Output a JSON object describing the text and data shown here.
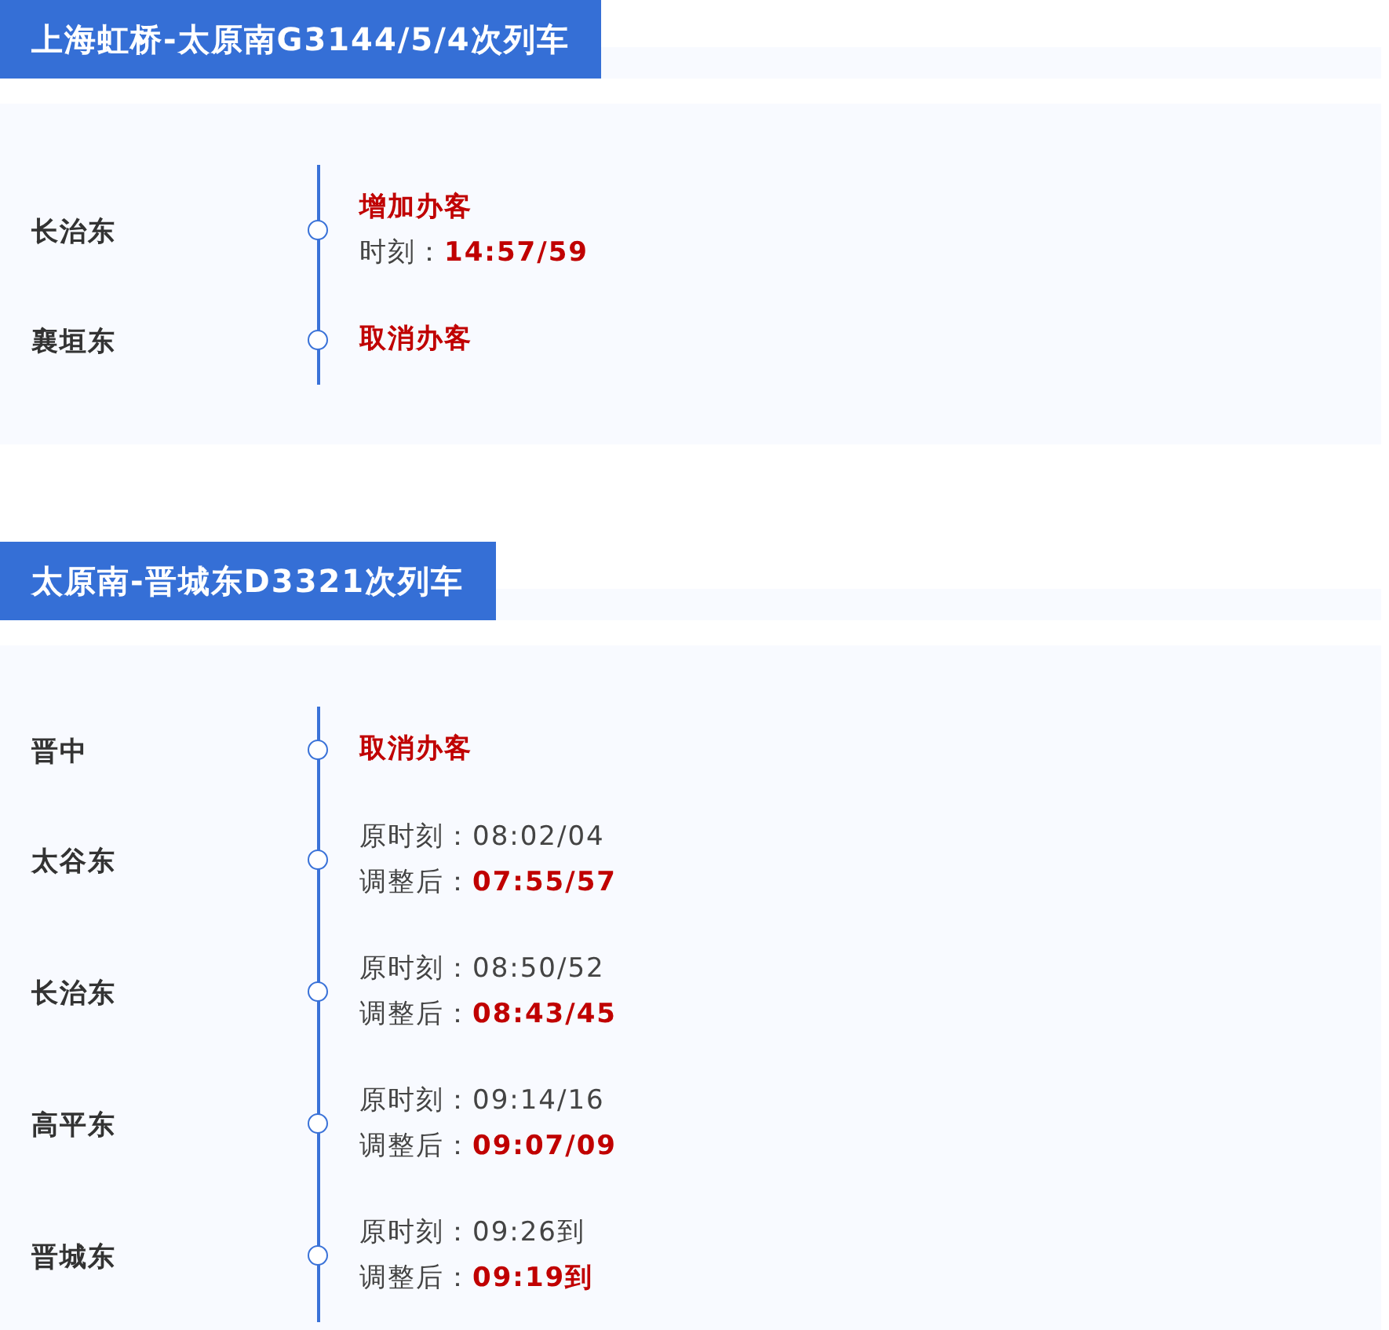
{
  "sections": [
    {
      "title": "上海虹桥-太原南G3144/5/4次列车",
      "stops": [
        {
          "station": "长治东",
          "lines": [
            {
              "kind": "notice",
              "text": "增加办客"
            },
            {
              "kind": "adjusted",
              "label": "时刻：",
              "value": "14:57/59"
            }
          ]
        },
        {
          "station": "襄垣东",
          "lines": [
            {
              "kind": "notice",
              "text": "取消办客"
            }
          ]
        }
      ]
    },
    {
      "title": "太原南-晋城东D3321次列车",
      "stops": [
        {
          "station": "晋中",
          "lines": [
            {
              "kind": "notice",
              "text": "取消办客"
            }
          ]
        },
        {
          "station": "太谷东",
          "lines": [
            {
              "kind": "original",
              "label": "原时刻：",
              "value": "08:02/04"
            },
            {
              "kind": "adjusted",
              "label": "调整后：",
              "value": "07:55/57"
            }
          ]
        },
        {
          "station": "长治东",
          "lines": [
            {
              "kind": "original",
              "label": "原时刻：",
              "value": "08:50/52"
            },
            {
              "kind": "adjusted",
              "label": "调整后：",
              "value": "08:43/45"
            }
          ]
        },
        {
          "station": "高平东",
          "lines": [
            {
              "kind": "original",
              "label": "原时刻：",
              "value": "09:14/16"
            },
            {
              "kind": "adjusted",
              "label": "调整后：",
              "value": "09:07/09"
            }
          ]
        },
        {
          "station": "晋城东",
          "lines": [
            {
              "kind": "original",
              "label": "原时刻：",
              "value": "09:26到"
            },
            {
              "kind": "adjusted",
              "label": "调整后：",
              "value": "09:19到"
            }
          ]
        }
      ]
    }
  ]
}
